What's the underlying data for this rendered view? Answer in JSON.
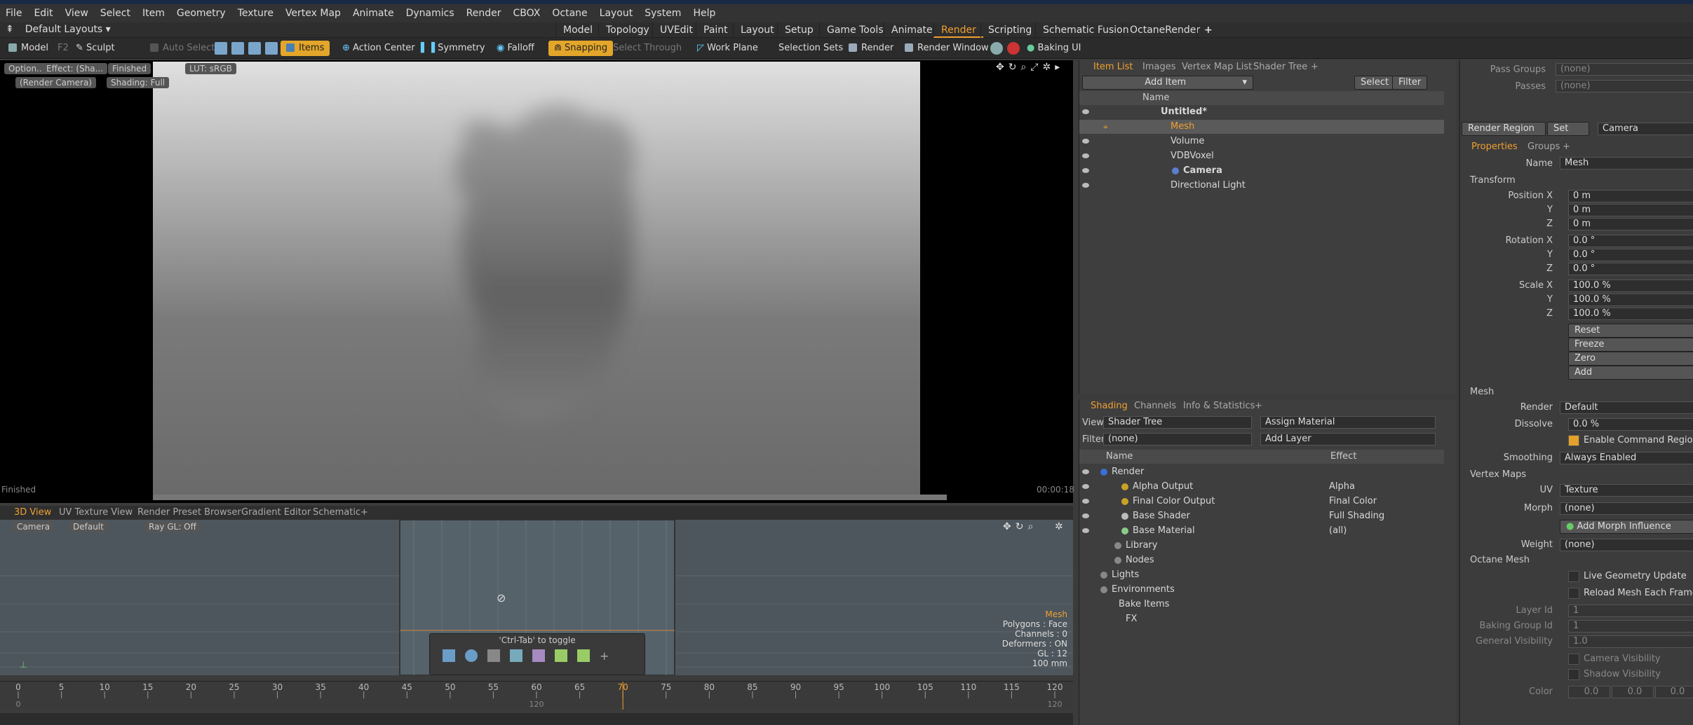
{
  "menubar": {
    "items": [
      "File",
      "Edit",
      "View",
      "Select",
      "Item",
      "Geometry",
      "Texture",
      "Vertex Map",
      "Animate",
      "Dynamics",
      "Render",
      "CBOX",
      "Octane",
      "Layout",
      "System",
      "Help"
    ]
  },
  "layouts": {
    "default_label": "Default Layouts",
    "tabs": [
      "Model",
      "Topology",
      "UVEdit",
      "Paint",
      "Layout",
      "Setup",
      "Game Tools",
      "Animate",
      "Render",
      "Scripting",
      "Schematic Fusion",
      "OctaneRender"
    ],
    "active_tab": "Render",
    "add": "+"
  },
  "toolbar": {
    "model": "Model",
    "f2": "F2",
    "sculpt": "Sculpt",
    "auto_select": "Auto Select",
    "items": "Items",
    "action_center": "Action Center",
    "symmetry": "Symmetry",
    "falloff": "Falloff",
    "snapping": "Snapping",
    "select_through": "Select Through",
    "work_plane": "Work Plane",
    "selection_sets": "Selection Sets",
    "render": "Render",
    "render_window": "Render Window",
    "baking_ui": "Baking UI"
  },
  "viewport": {
    "tags": [
      "Option...",
      "Effect: (Sha...",
      "Finished",
      "LUT: sRGB",
      "(Render Camera)",
      "Shading: Full"
    ],
    "status_left": "Finished",
    "time": "00:00:18"
  },
  "bottom_viewport": {
    "tabs": [
      "3D View",
      "UV Texture View",
      "Render Preset Browser",
      "Gradient Editor",
      "Schematic",
      "+"
    ],
    "active": "3D View",
    "camera": "Camera",
    "default": "Default",
    "raygl": "Ray GL: Off",
    "toggle_hint": "'Ctrl-Tab' to toggle",
    "info": {
      "item": "Mesh",
      "polygons": "Polygons : Face",
      "channels": "Channels : 0",
      "deformers": "Deformers : ON",
      "gl": "GL : 12",
      "size": "100 mm"
    }
  },
  "timeline": {
    "ticks": [
      "0",
      "5",
      "10",
      "15",
      "20",
      "25",
      "30",
      "35",
      "40",
      "45",
      "50",
      "55",
      "60",
      "65",
      "70",
      "75",
      "80",
      "85",
      "90",
      "95",
      "100",
      "105",
      "110",
      "115",
      "120"
    ],
    "sub_ticks": [
      "0",
      "120",
      "120"
    ],
    "current": "70"
  },
  "item_list": {
    "tabs": [
      "Item List",
      "Images",
      "Vertex Map List",
      "Shader Tree",
      "+"
    ],
    "active": "Item List",
    "add_item": "Add Item",
    "select": "Select",
    "filter": "Filter",
    "column": "Name",
    "rows": [
      {
        "name": "Untitled*",
        "bold": true
      },
      {
        "name": "Mesh",
        "selected": true
      },
      {
        "name": "Volume"
      },
      {
        "name": "VDBVoxel"
      },
      {
        "name": "Camera",
        "bold": true
      },
      {
        "name": "Directional Light"
      }
    ]
  },
  "shading": {
    "tabs": [
      "Shading",
      "Channels",
      "Info & Statistics",
      "+"
    ],
    "active": "Shading",
    "view_label": "View",
    "view_value": "Shader Tree",
    "assign_material": "Assign Material",
    "filter_label": "Filter",
    "filter_value": "(none)",
    "add_layer": "Add Layer",
    "col_name": "Name",
    "col_effect": "Effect",
    "rows": [
      {
        "name": "Render",
        "effect": ""
      },
      {
        "name": "Alpha Output",
        "effect": "Alpha"
      },
      {
        "name": "Final Color Output",
        "effect": "Final Color"
      },
      {
        "name": "Base Shader",
        "effect": "Full Shading"
      },
      {
        "name": "Base Material",
        "effect": "(all)"
      },
      {
        "name": "Library",
        "effect": ""
      },
      {
        "name": "Nodes",
        "effect": ""
      },
      {
        "name": "Lights",
        "effect": ""
      },
      {
        "name": "Environments",
        "effect": ""
      },
      {
        "name": "Bake Items",
        "effect": ""
      },
      {
        "name": "FX",
        "effect": ""
      }
    ]
  },
  "properties": {
    "pass_groups_label": "Pass Groups",
    "pass_groups_value": "(none)",
    "passes_label": "Passes",
    "passes_value": "(none)",
    "render_region": "Render Region",
    "set": "Set",
    "camera": "Camera",
    "tabs": [
      "Properties",
      "Groups",
      "+"
    ],
    "active": "Properties",
    "name_label": "Name",
    "name_value": "Mesh",
    "transform": "Transform",
    "position_x": "Position X",
    "y": "Y",
    "z": "Z",
    "pos": [
      "0 m",
      "0 m",
      "0 m"
    ],
    "rotation_x": "Rotation X",
    "rot": [
      "0.0 °",
      "0.0 °",
      "0.0 °"
    ],
    "scale_x": "Scale X",
    "scale": [
      "100.0 %",
      "100.0 %",
      "100.0 %"
    ],
    "actions": [
      "Reset",
      "Freeze",
      "Zero",
      "Add"
    ],
    "mesh": "Mesh",
    "render_label": "Render",
    "render_value": "Default",
    "dissolve_label": "Dissolve",
    "dissolve_value": "0.0 %",
    "enable_cmd": "Enable Command Regions",
    "smoothing_label": "Smoothing",
    "smoothing_value": "Always Enabled",
    "vertex_maps": "Vertex Maps",
    "uv_label": "UV",
    "uv_value": "Texture",
    "morph_label": "Morph",
    "morph_value": "(none)",
    "add_morph": "Add Morph Influence",
    "weight_label": "Weight",
    "weight_value": "(none)",
    "octane_mesh": "Octane Mesh",
    "live_geo": "Live Geometry Update",
    "reload_mesh": "Reload Mesh Each Frame",
    "layer_id_label": "Layer Id",
    "layer_id": "1",
    "baking_label": "Baking Group Id",
    "baking": "1",
    "gen_vis_label": "General Visibility",
    "gen_vis": "1.0",
    "cam_vis": "Camera Visibility",
    "shadow_vis": "Shadow Visibility",
    "color_label": "Color",
    "color": [
      "0.0",
      "0.0",
      "0.0"
    ]
  }
}
